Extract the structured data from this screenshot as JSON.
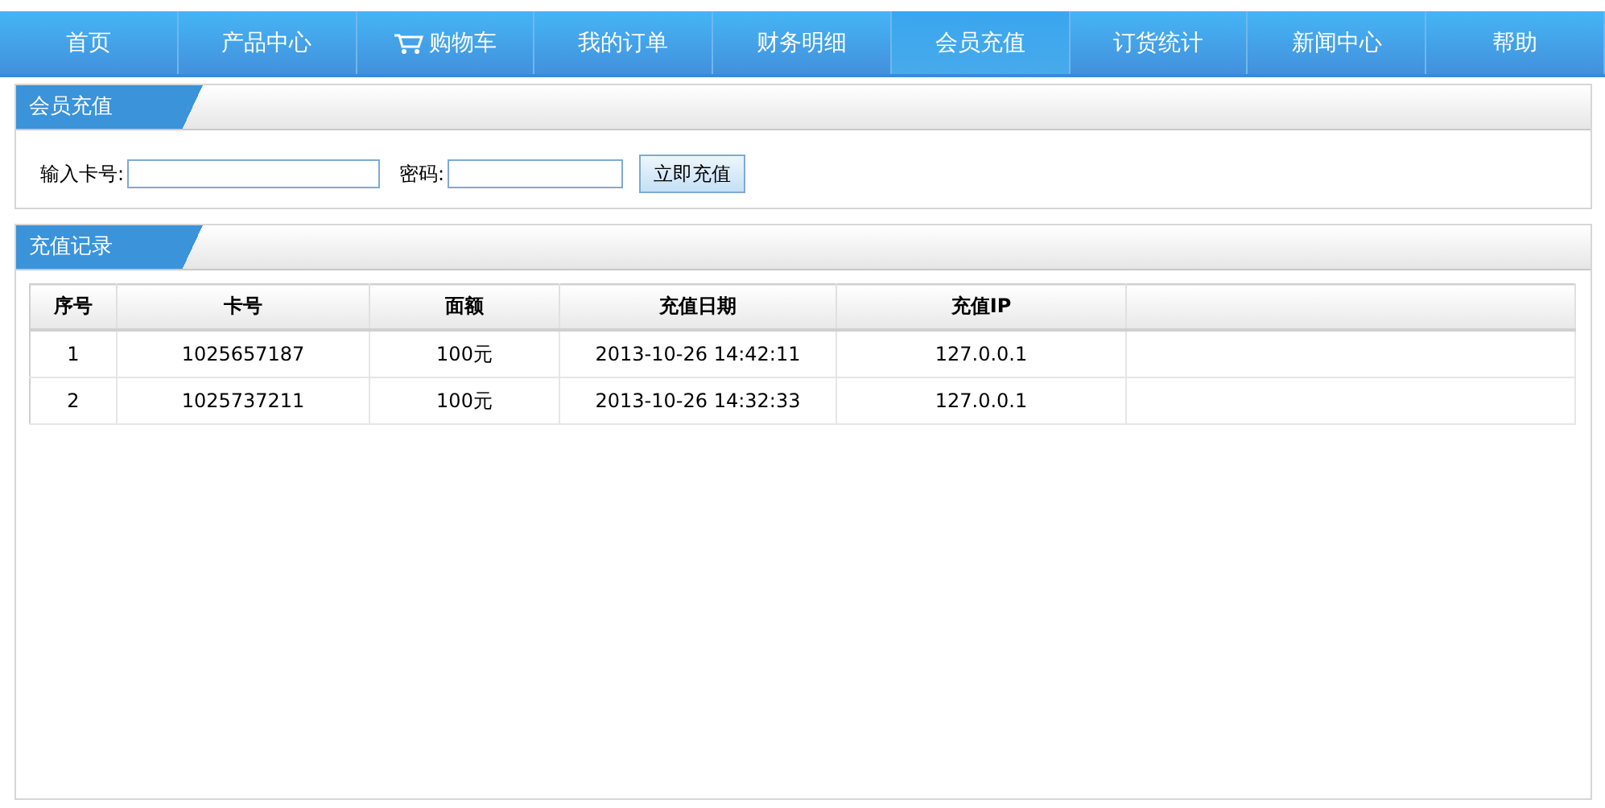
{
  "nav": [
    {
      "label": "首页",
      "selected": false,
      "cart_icon": false
    },
    {
      "label": "产品中心",
      "selected": false,
      "cart_icon": false
    },
    {
      "label": "购物车",
      "selected": false,
      "cart_icon": true
    },
    {
      "label": "我的订单",
      "selected": false,
      "cart_icon": false
    },
    {
      "label": "财务明细",
      "selected": false,
      "cart_icon": false
    },
    {
      "label": "会员充值",
      "selected": true,
      "cart_icon": false
    },
    {
      "label": "订货统计",
      "selected": false,
      "cart_icon": false
    },
    {
      "label": "新闻中心",
      "selected": false,
      "cart_icon": false
    },
    {
      "label": "帮助",
      "selected": false,
      "cart_icon": false
    }
  ],
  "recharge": {
    "title": "会员充值",
    "card_label": "输入卡号:",
    "password_label": "密码:",
    "button": "立即充值"
  },
  "records": {
    "title": "充值记录",
    "columns": [
      "序号",
      "卡号",
      "面额",
      "充值日期",
      "充值IP"
    ],
    "rows": [
      [
        "1",
        "1025657187",
        "100元",
        "2013-10-26 14:42:11",
        "127.0.0.1"
      ],
      [
        "2",
        "1025737211",
        "100元",
        "2013-10-26 14:32:33",
        "127.0.0.1"
      ]
    ]
  }
}
